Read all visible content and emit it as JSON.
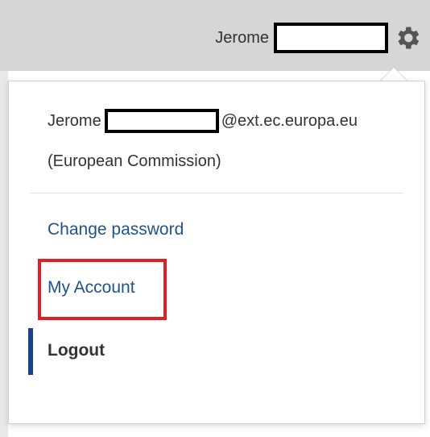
{
  "header": {
    "username": "Jerome",
    "settings_icon": "gear-icon"
  },
  "menu": {
    "email_prefix": "Jerome",
    "email_suffix": "@ext.ec.europa.eu",
    "organization": "(European Commission)",
    "items": [
      {
        "label": "Change password"
      },
      {
        "label": "My Account"
      },
      {
        "label": "Logout"
      }
    ]
  },
  "colors": {
    "link": "#1f5289",
    "highlight": "#e01f26",
    "active_bar": "#1b3f8f"
  }
}
